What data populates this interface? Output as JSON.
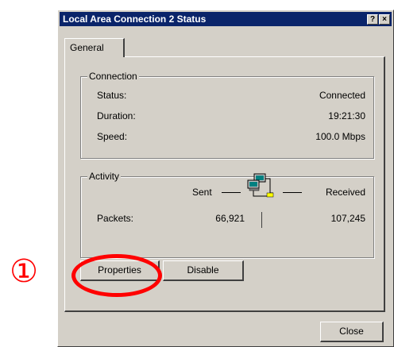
{
  "window": {
    "title": "Local Area Connection 2 Status",
    "help_symbol": "?",
    "close_symbol": "×"
  },
  "tabs": [
    {
      "label": "General",
      "selected": true
    }
  ],
  "connection": {
    "group_label": "Connection",
    "rows": [
      {
        "label": "Status:",
        "value": "Connected"
      },
      {
        "label": "Duration:",
        "value": "19:21:30"
      },
      {
        "label": "Speed:",
        "value": "100.0 Mbps"
      }
    ]
  },
  "activity": {
    "group_label": "Activity",
    "sent_label": "Sent",
    "received_label": "Received",
    "packets_label": "Packets:",
    "packets_sent": "66,921",
    "packets_received": "107,245",
    "icon": "network-computers-icon"
  },
  "buttons": {
    "properties": "Properties",
    "disable": "Disable",
    "close": "Close"
  },
  "annotation": {
    "marker": "①",
    "color": "#ff0000"
  }
}
